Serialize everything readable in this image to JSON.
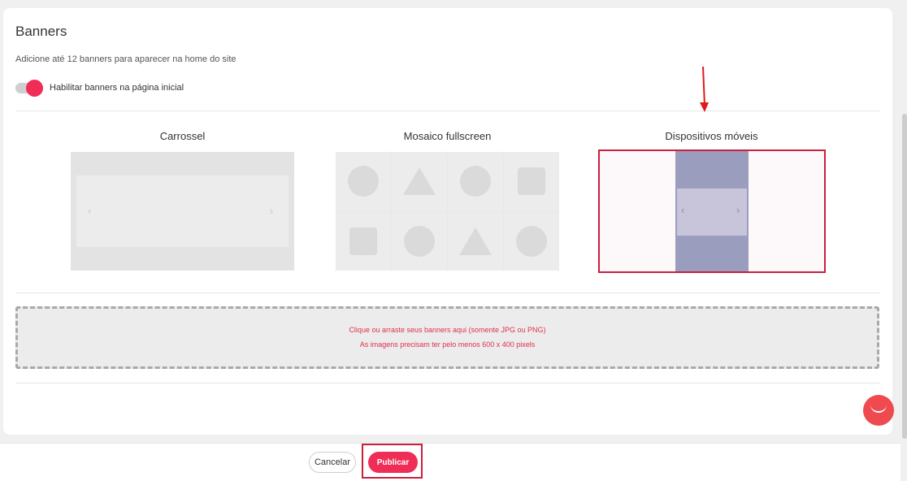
{
  "banners": {
    "title": "Banners",
    "subtitle": "Adicione até 12 banners para aparecer na home do site",
    "toggle_label": "Habilitar banners na página inicial",
    "toggle_on": true
  },
  "layout_options": [
    {
      "label": "Carrossel",
      "icon": "carousel-preview"
    },
    {
      "label": "Mosaico fullscreen",
      "icon": "mosaic-preview"
    },
    {
      "label": "Dispositivos móveis",
      "icon": "mobile-preview"
    }
  ],
  "dropzone": {
    "line1": "Clique ou arraste seus banners aqui (somente JPG ou PNG)",
    "line2": "As imagens precisam ter pelo menos 600 x 400 pixels"
  },
  "footer": {
    "cancel_label": "Cancelar",
    "publish_label": "Publicar"
  },
  "colors": {
    "accent": "#ef2d56",
    "highlight_frame": "#c9203e",
    "annotation_arrow": "#e01a1a",
    "mobile_phone": "#9a9dbd"
  },
  "icons": {
    "arrow": "annotation-arrow-down",
    "chat": "chat-bubble-icon",
    "chev_left": "‹",
    "chev_right": "›"
  }
}
